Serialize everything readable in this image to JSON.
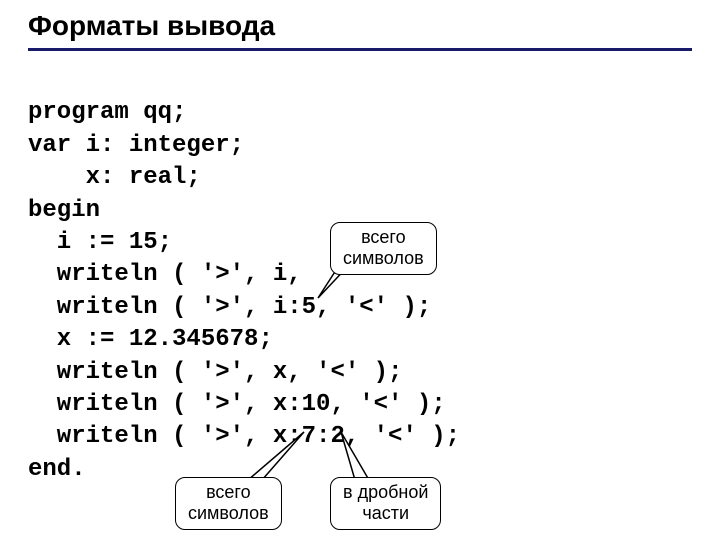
{
  "title": "Форматы вывода",
  "code": {
    "l1": "program qq;",
    "l2": "var i: integer;",
    "l3": "    x: real;",
    "l4": "begin",
    "l5": "  i := 15;",
    "l6": "  writeln ( '>', i,",
    "l7": "  writeln ( '>', i:5, '<' );",
    "l8": "  x := 12.345678;",
    "l9": "  writeln ( '>', x, '<' );",
    "l10": "  writeln ( '>', x:10, '<' );",
    "l11": "  writeln ( '>', x:7:2, '<' );",
    "l12": "end."
  },
  "callouts": {
    "total1_l1": "всего",
    "total1_l2": "символов",
    "total2_l1": "всего",
    "total2_l2": "символов",
    "frac_l1": "в дробной",
    "frac_l2": "части"
  }
}
